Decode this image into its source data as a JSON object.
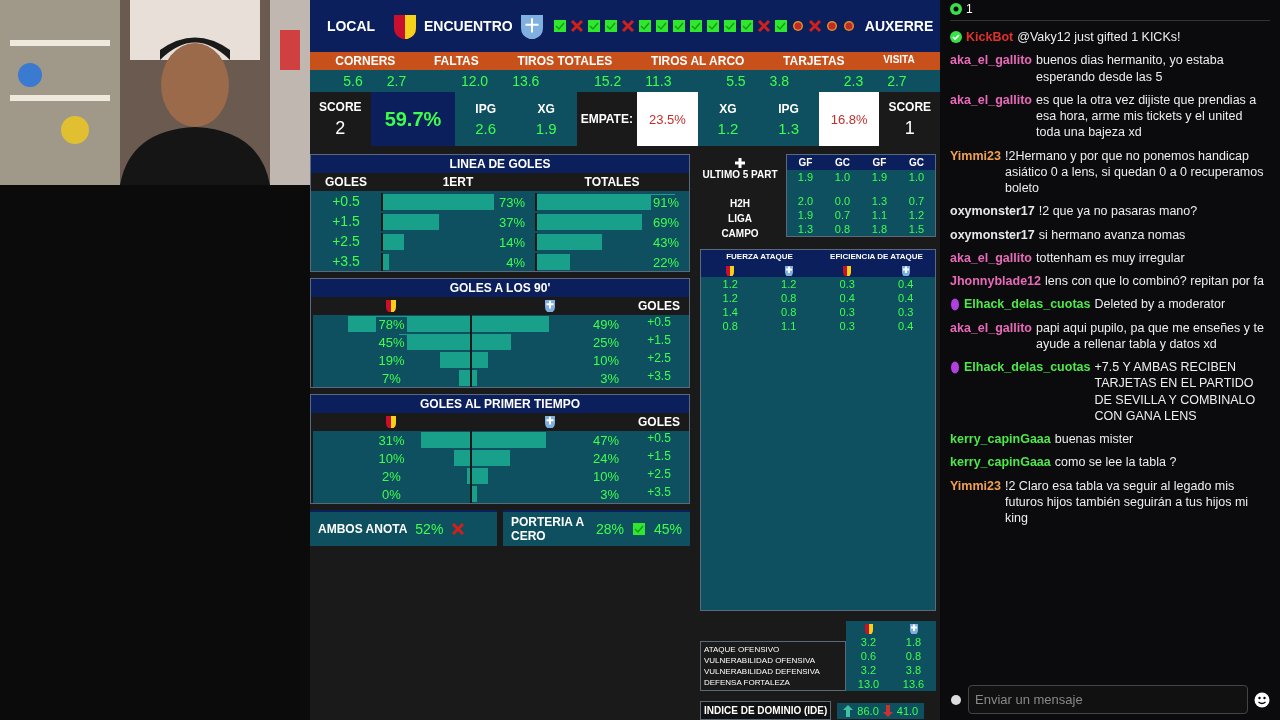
{
  "sheet": {
    "title": "ENCUENTRO",
    "home_label": "LOCAL",
    "away_label": "AUXERRE",
    "marks": [
      {
        "kind": "check"
      },
      {
        "kind": "cross"
      },
      {
        "kind": "check"
      },
      {
        "kind": "check"
      },
      {
        "kind": "cross"
      },
      {
        "kind": "check"
      },
      {
        "kind": "check"
      },
      {
        "kind": "check"
      },
      {
        "kind": "check"
      },
      {
        "kind": "check"
      },
      {
        "kind": "check"
      },
      {
        "kind": "check"
      },
      {
        "kind": "cross"
      },
      {
        "kind": "check"
      },
      {
        "kind": "card"
      },
      {
        "kind": "cross"
      },
      {
        "kind": "card"
      },
      {
        "kind": "card"
      }
    ],
    "stats": [
      {
        "label": "CORNERS",
        "home": "5.6",
        "away": "2.7"
      },
      {
        "label": "FALTAS",
        "home": "12.0",
        "away": "13.6"
      },
      {
        "label": "TIROS TOTALES",
        "home": "15.2",
        "away": "11.3"
      },
      {
        "label": "TIROS AL ARCO",
        "home": "5.5",
        "away": "3.8"
      },
      {
        "label": "TARJETAS",
        "home": "2.3",
        "away": "2.7"
      }
    ],
    "visita_label": "VISITA",
    "home": {
      "score_label": "SCORE",
      "score": "2",
      "win": "59.7%",
      "ipg_label": "IPG",
      "ipg": "2.6",
      "xg_label": "XG",
      "xg": "1.9"
    },
    "draw": {
      "label": "EMPATE:",
      "value": "23.5%"
    },
    "away": {
      "xg_label": "XG",
      "xg": "1.2",
      "ipg_label": "IPG",
      "ipg": "1.3",
      "win": "16.8%",
      "score_label": "SCORE",
      "score": "1"
    },
    "goal_lines": {
      "title": "LINEA DE GOLES",
      "columns": [
        "GOLES",
        "1ERT",
        "TOTALES"
      ],
      "rows": [
        {
          "line": "+0.5",
          "first": {
            "value": "73%",
            "level": 0.73
          },
          "total": {
            "value": "91%",
            "level": 0.91
          }
        },
        {
          "line": "+1.5",
          "first": {
            "value": "37%",
            "level": 0.37
          },
          "total": {
            "value": "69%",
            "level": 0.69
          }
        },
        {
          "line": "+2.5",
          "first": {
            "value": "14%",
            "level": 0.14
          },
          "total": {
            "value": "43%",
            "level": 0.43
          }
        },
        {
          "line": "+3.5",
          "first": {
            "value": "4%",
            "level": 0.04
          },
          "total": {
            "value": "22%",
            "level": 0.22
          }
        }
      ]
    },
    "recent": {
      "label": "ULTIMO 5 PART",
      "columns": [
        "GF",
        "GC",
        "GF",
        "GC"
      ],
      "rows": [
        {
          "values": [
            "1.9",
            "1.0",
            "1.9",
            "1.0"
          ]
        },
        {
          "label": "H2H",
          "values": [
            "2.0",
            "0.0",
            "1.3",
            "0.7"
          ]
        },
        {
          "label": "LIGA",
          "values": [
            "1.9",
            "0.7",
            "1.1",
            "1.2"
          ]
        },
        {
          "label": "CAMPO",
          "values": [
            "1.3",
            "0.8",
            "1.8",
            "1.5"
          ]
        }
      ]
    },
    "goals_90": {
      "title": "GOLES A LOS 90'",
      "lines_label": "GOLES",
      "lines": [
        "+0.5",
        "+1.5",
        "+2.5",
        "+3.5"
      ],
      "rows": [
        {
          "home": {
            "value": "78%",
            "level": 0.78
          },
          "away": {
            "value": "49%",
            "level": 0.49
          }
        },
        {
          "home": {
            "value": "45%",
            "level": 0.45
          },
          "away": {
            "value": "25%",
            "level": 0.25
          }
        },
        {
          "home": {
            "value": "19%",
            "level": 0.19
          },
          "away": {
            "value": "10%",
            "level": 0.1
          }
        },
        {
          "home": {
            "value": "7%",
            "level": 0.07
          },
          "away": {
            "value": "3%",
            "level": 0.03
          }
        }
      ]
    },
    "goals_1t": {
      "title": "GOLES AL PRIMER TIEMPO",
      "lines_label": "GOLES",
      "lines": [
        "+0.5",
        "+1.5",
        "+2.5",
        "+3.5"
      ],
      "rows": [
        {
          "home": {
            "value": "31%",
            "level": 0.31
          },
          "away": {
            "value": "47%",
            "level": 0.47
          }
        },
        {
          "home": {
            "value": "10%",
            "level": 0.1
          },
          "away": {
            "value": "24%",
            "level": 0.24
          }
        },
        {
          "home": {
            "value": "2%",
            "level": 0.02
          },
          "away": {
            "value": "10%",
            "level": 0.1
          }
        },
        {
          "home": {
            "value": "0%"
          },
          "away": {
            "value": "3%",
            "level": 0.03
          }
        }
      ]
    },
    "attack": {
      "groups": [
        "FUERZA ATAQUE",
        "EFICIENCIA DE ATAQUE"
      ],
      "rows": [
        [
          "1.2",
          "1.2",
          "0.3",
          "0.4"
        ],
        [
          "1.2",
          "0.8",
          "0.4",
          "0.4"
        ],
        [
          "1.4",
          "0.8",
          "0.3",
          "0.3"
        ],
        [
          "0.8",
          "1.1",
          "0.3",
          "0.4"
        ]
      ]
    },
    "indices": [
      {
        "label": "ATAQUE OFENSIVO",
        "home": "3.2",
        "away": "1.8"
      },
      {
        "label": "VULNERABILIDAD OFENSIVA",
        "home": "0.6",
        "away": "0.8"
      },
      {
        "label": "VULNERABILIDAD DEFENSIVA",
        "home": "3.2",
        "away": "3.8"
      },
      {
        "label": "DEFENSA FORTALEZA",
        "home": "13.0",
        "away": "13.6"
      }
    ],
    "dominance": {
      "label": "INDICE DE DOMINIO (IDE)",
      "home": "86.0",
      "away": "41.0"
    },
    "both_score": {
      "label": "AMBOS ANOTA",
      "value": "52%",
      "kind": "cross"
    },
    "clean_sheet": {
      "label": "PORTERIA A CERO",
      "home": "28%",
      "kind": "check",
      "away": "45%"
    }
  },
  "chat": {
    "viewer_count": "1",
    "messages": [
      {
        "user": "KickBot",
        "color": "#e0302a",
        "kind": "verified",
        "text": "@Vaky12 just gifted 1 KICKs!"
      },
      {
        "user": "aka_el_gallito",
        "color": "#e86ab8",
        "kind": "plain",
        "text": "buenos dias hermanito, yo estaba esperando desde las 5"
      },
      {
        "user": "aka_el_gallito",
        "color": "#e86ab8",
        "kind": "plain",
        "text": "es que la otra vez dijiste que prendias a esa hora, arme mis tickets y el united toda una bajeza xd"
      },
      {
        "user": "Yimmi23",
        "color": "#f0a050",
        "kind": "plain",
        "text": "!2Hermano y por que no ponemos handicap asiático 0 a lens, si quedan 0 a 0 recuperamos boleto"
      },
      {
        "user": "oxymonster17",
        "color": "#e8e8e8",
        "kind": "plain",
        "text": "!2 que ya no pasaras mano?"
      },
      {
        "user": "oxymonster17",
        "color": "#e8e8e8",
        "kind": "plain",
        "text": "si hermano avanza nomas"
      },
      {
        "user": "aka_el_gallito",
        "color": "#e86ab8",
        "kind": "plain",
        "text": "tottenham es muy irregular"
      },
      {
        "user": "Jhonnyblade12",
        "color": "#e86ab8",
        "kind": "plain",
        "text": "lens con que lo combinó? repitan por fa"
      },
      {
        "user": "Elhack_delas_cuotas",
        "color": "#4ee84a",
        "kind": "gem",
        "text": "Deleted by a moderator"
      },
      {
        "user": "aka_el_gallito",
        "color": "#e86ab8",
        "kind": "plain",
        "text": "papi aqui pupilo, pa que me enseñes y te ayude a rellenar tabla y datos xd"
      },
      {
        "user": "Elhack_delas_cuotas",
        "color": "#4ee84a",
        "kind": "gem",
        "text": "+7.5 Y AMBAS RECIBEN TARJETAS EN EL PARTIDO DE SEVILLA Y COMBINALO CON GANA LENS"
      },
      {
        "user": "kerry_capinGaaa",
        "color": "#4ee84a",
        "kind": "plain",
        "text": "buenas mister"
      },
      {
        "user": "kerry_capinGaaa",
        "color": "#4ee84a",
        "kind": "plain",
        "text": "como se lee la tabla ?"
      },
      {
        "user": "Yimmi23",
        "color": "#f0a050",
        "kind": "plain",
        "text": "!2 Claro esa tabla va seguir al legado mis futuros hijos también seguirán a tus hijos mi king"
      }
    ],
    "input": {
      "placeholder": "Enviar un mensaje"
    }
  }
}
